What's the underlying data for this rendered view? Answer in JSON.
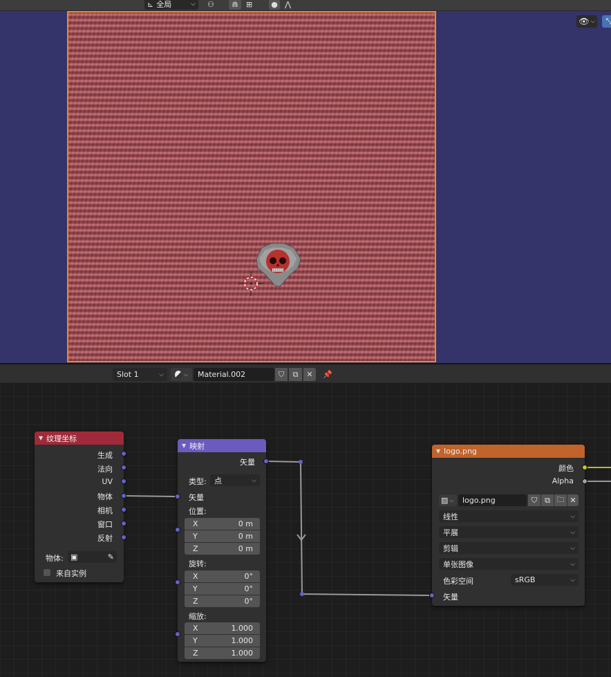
{
  "toolbar": {
    "transform_orientation": "全局",
    "snap_icon": "magnet-icon",
    "proportional_icon": "proportional-edit-icon"
  },
  "viewport": {
    "background_color": "#34336a",
    "selection_outline_color": "#f08a22",
    "visibility_icon": "eye-icon",
    "gizmo_icon": "gizmo-icon"
  },
  "node_header": {
    "slot": "Slot 1",
    "material_name": "Material.002"
  },
  "nodes": {
    "tex_coord": {
      "title": "纹理坐标",
      "header_color": "#a02a39",
      "outputs": [
        "生成",
        "法向",
        "UV",
        "物体",
        "相机",
        "窗口",
        "反射"
      ],
      "object_label": "物体:",
      "from_instancer_label": "来自实例"
    },
    "mapping": {
      "title": "映射",
      "header_color": "#6b5bbf",
      "output": "矢量",
      "type_label": "类型:",
      "type_value": "点",
      "vector_label": "矢量",
      "location_label": "位置:",
      "location": [
        {
          "axis": "X",
          "value": "0 m"
        },
        {
          "axis": "Y",
          "value": "0 m"
        },
        {
          "axis": "Z",
          "value": "0 m"
        }
      ],
      "rotation_label": "旋转:",
      "rotation": [
        {
          "axis": "X",
          "value": "0°"
        },
        {
          "axis": "Y",
          "value": "0°"
        },
        {
          "axis": "Z",
          "value": "0°"
        }
      ],
      "scale_label": "缩放:",
      "scale": [
        {
          "axis": "X",
          "value": "1.000"
        },
        {
          "axis": "Y",
          "value": "1.000"
        },
        {
          "axis": "Z",
          "value": "1.000"
        }
      ]
    },
    "image_texture": {
      "title": "logo.png",
      "header_color": "#c1632a",
      "outputs": [
        "颜色",
        "Alpha"
      ],
      "image_name": "logo.png",
      "interpolation": "线性",
      "projection": "平展",
      "extension": "剪辑",
      "source": "单张图像",
      "color_space_label": "色彩空间",
      "color_space": "sRGB",
      "vector_input": "矢量"
    }
  }
}
